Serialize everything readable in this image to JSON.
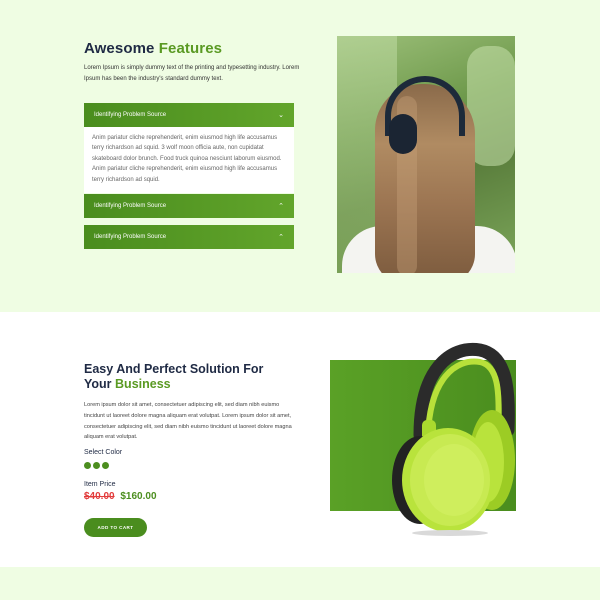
{
  "features": {
    "title_main": "Awesome",
    "title_accent": "Features",
    "description": "Lorem Ipsum is simply dummy text of the printing and typesetting industry. Lorem Ipsum has been the industry's standard dummy text.",
    "accordion": [
      {
        "label": "Identifying Problem Source",
        "expanded": true,
        "body": "Anim pariatur cliche reprehenderit, enim eiusmod high life accusamus terry richardson ad squid. 3 wolf moon officia aute, non cupidatat skateboard dolor brunch. Food truck quinoa nesciunt laborum eiusmod. Anim pariatur cliche reprehenderit, enim eiusmod high life accusamus terry richardson ad squid."
      },
      {
        "label": "Identifying Problem Source",
        "expanded": false
      },
      {
        "label": "Identifying Problem Source",
        "expanded": false
      }
    ],
    "chevron_up": "⌃",
    "chevron_down": "⌄"
  },
  "solution": {
    "title_main": "Easy And Perfect Solution For Your",
    "title_accent": "Business",
    "description": "Lorem ipsum dolor sit amet, consectetuer adipiscing elit, sed diam nibh euismo tincidunt ut laoreet dolore magna aliquam erat volutpat. Lorem ipsum dolor sit amet, consectetuer adipiscing elit, sed diam nibh euismo tincidunt ut laoreet dolore magna aliquam erat volutpat.",
    "color_label": "Select Color",
    "swatches": [
      "#4c8e1f",
      "#4c8e1f",
      "#4c8e1f"
    ],
    "price_label": "Item Price",
    "old_price": "$40.00",
    "new_price": "$160.00",
    "cart_label": "ADD TO CART"
  },
  "colors": {
    "accent": "#5a9a23",
    "button": "#4a8d1e",
    "old_price": "#e23b3b",
    "section_bg": "#effde3"
  }
}
